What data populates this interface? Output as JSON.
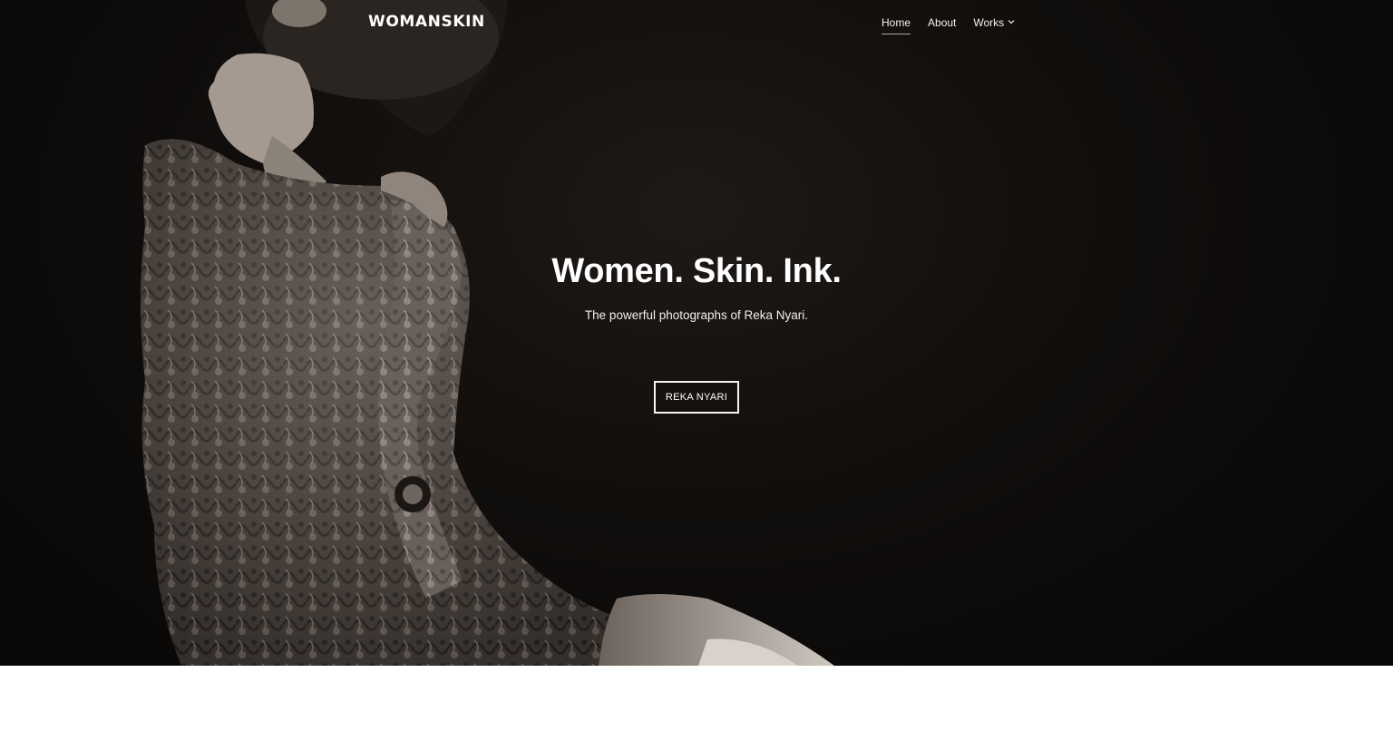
{
  "header": {
    "logo": "WOMANSKIN",
    "nav": [
      {
        "label": "Home",
        "active": true
      },
      {
        "label": "About",
        "active": false
      },
      {
        "label": "Works",
        "active": false,
        "has_dropdown": true
      }
    ]
  },
  "hero": {
    "title": "Women. Skin. Ink.",
    "subtitle": "The powerful photographs of Reka Nyari.",
    "cta_label": "REKA NYARI",
    "image_icon": "tattooed-woman-photo"
  },
  "colors": {
    "hero_bg": "#0f0d0c",
    "text": "#ffffff",
    "page_bg": "#ffffff"
  }
}
